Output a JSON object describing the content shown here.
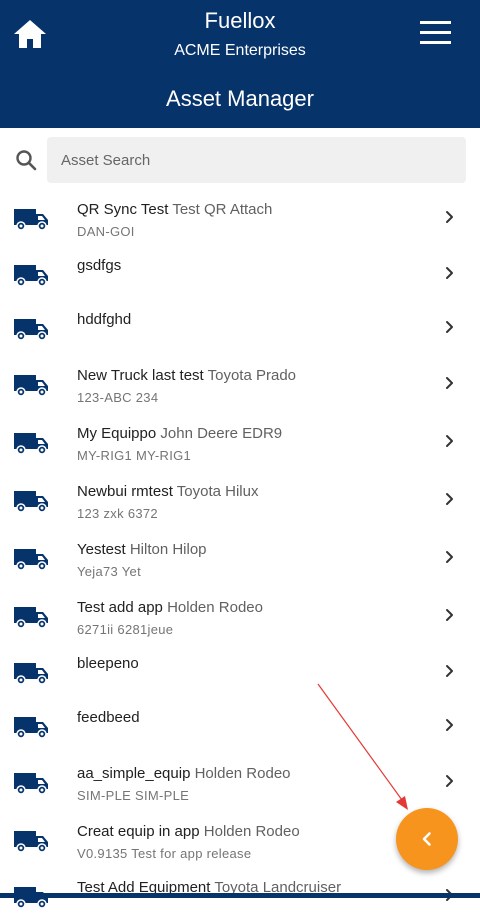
{
  "header": {
    "app_title": "Fuellox",
    "org_name": "ACME Enterprises",
    "page_title": "Asset Manager",
    "home_icon": "home-icon",
    "menu_icon": "hamburger-menu-icon"
  },
  "search": {
    "placeholder": "Asset Search",
    "value": ""
  },
  "assets": [
    {
      "name": "QR Sync Test",
      "desc": "Test QR Attach",
      "sub": "DAN-GOI"
    },
    {
      "name": "gsdfgs",
      "desc": "",
      "sub": ""
    },
    {
      "name": "hddfghd",
      "desc": "",
      "sub": ""
    },
    {
      "name": "New Truck last test",
      "desc": "Toyota Prado",
      "sub": "123-ABC 234"
    },
    {
      "name": "My Equippo",
      "desc": "John Deere EDR9",
      "sub": "MY-RIG1 MY-RIG1"
    },
    {
      "name": "Newbui rmtest",
      "desc": "Toyota Hilux",
      "sub": "123 zxk 6372"
    },
    {
      "name": "Yestest",
      "desc": "Hilton Hilop",
      "sub": "Yeja73 Yet"
    },
    {
      "name": "Test add app",
      "desc": "Holden Rodeo",
      "sub": "6271ii 6281jeue"
    },
    {
      "name": "bleepeno",
      "desc": "",
      "sub": ""
    },
    {
      "name": "feedbeed",
      "desc": "",
      "sub": ""
    },
    {
      "name": "aa_simple_equip",
      "desc": "Holden Rodeo",
      "sub": "SIM-PLE SIM-PLE"
    },
    {
      "name": "Creat equip in app",
      "desc": "Holden Rodeo",
      "sub": "V0.9135 Test for app release"
    },
    {
      "name": "Test Add Equipment",
      "desc": "Toyota Landcruiser",
      "sub": ""
    }
  ],
  "fab": {
    "icon": "chevron-left-icon"
  },
  "colors": {
    "header": "#07336b",
    "accent": "#f7941e",
    "truck": "#07336b"
  }
}
